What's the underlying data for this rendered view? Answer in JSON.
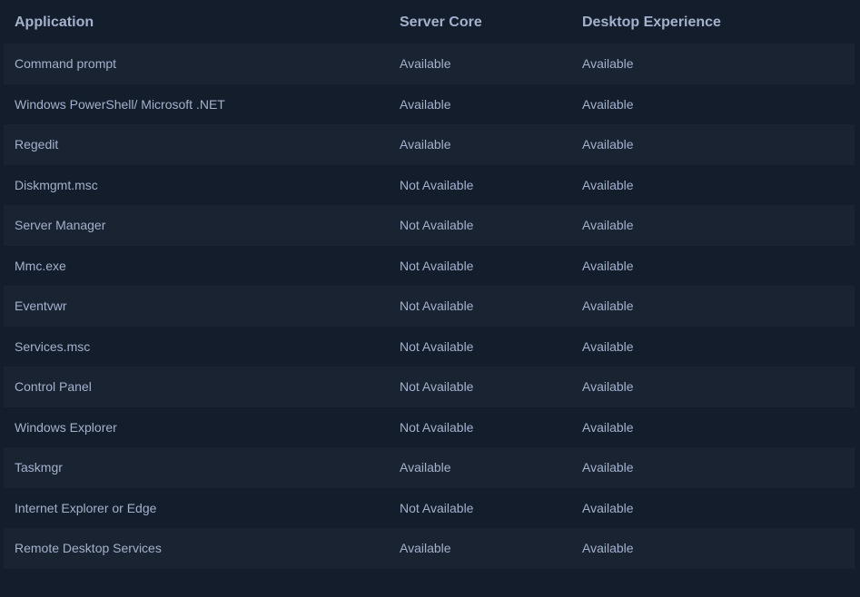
{
  "table": {
    "headers": [
      "Application",
      "Server Core",
      "Desktop Experience"
    ],
    "rows": [
      [
        "Command prompt",
        "Available",
        "Available"
      ],
      [
        "Windows PowerShell/ Microsoft .NET",
        "Available",
        "Available"
      ],
      [
        "Regedit",
        "Available",
        "Available"
      ],
      [
        "Diskmgmt.msc",
        "Not Available",
        "Available"
      ],
      [
        "Server Manager",
        "Not Available",
        "Available"
      ],
      [
        "Mmc.exe",
        "Not Available",
        "Available"
      ],
      [
        "Eventvwr",
        "Not Available",
        "Available"
      ],
      [
        "Services.msc",
        "Not Available",
        "Available"
      ],
      [
        "Control Panel",
        "Not Available",
        "Available"
      ],
      [
        "Windows Explorer",
        "Not Available",
        "Available"
      ],
      [
        "Taskmgr",
        "Available",
        "Available"
      ],
      [
        "Internet Explorer or Edge",
        "Not Available",
        "Available"
      ],
      [
        "Remote Desktop Services",
        "Available",
        "Available"
      ]
    ]
  },
  "colors": {
    "background": "#141d2b",
    "row_alt": "#1a2332",
    "text": "#a4b1cd"
  }
}
